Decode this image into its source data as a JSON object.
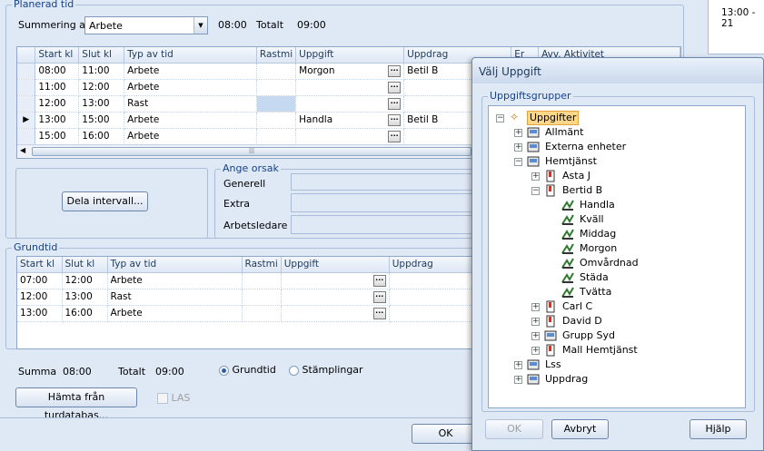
{
  "planerad": {
    "title": "Planerad tid",
    "summering_label": "Summering av",
    "summering_value": "Arbete",
    "sum_time": "08:00",
    "totalt_label": "Totalt",
    "totalt_time": "09:00",
    "columns": [
      "Start kl",
      "Slut kl",
      "Typ av tid",
      "Rastmi",
      "Uppgift",
      "Uppdrag",
      "Er",
      "Avv. Aktivitet"
    ],
    "rows": [
      {
        "start": "08:00",
        "slut": "11:00",
        "typ": "Arbete",
        "uppgift": "Morgon",
        "uppdrag": "Betil B"
      },
      {
        "start": "11:00",
        "slut": "12:00",
        "typ": "Arbete",
        "uppgift": "",
        "uppdrag": ""
      },
      {
        "start": "12:00",
        "slut": "13:00",
        "typ": "Rast",
        "uppgift": "",
        "uppdrag": ""
      },
      {
        "start": "13:00",
        "slut": "15:00",
        "typ": "Arbete",
        "uppgift": "Handla",
        "uppdrag": "Betil B"
      },
      {
        "start": "15:00",
        "slut": "16:00",
        "typ": "Arbete",
        "uppgift": "",
        "uppdrag": ""
      }
    ],
    "dela_button": "Dela intervall...",
    "orsak_title": "Ange orsak",
    "orsak_fields": [
      "Generell",
      "Extra",
      "Arbetsledare"
    ]
  },
  "grundtid": {
    "title": "Grundtid",
    "columns": [
      "Start kl",
      "Slut kl",
      "Typ av tid",
      "Rastmi",
      "Uppgift",
      "Uppdrag"
    ],
    "rows": [
      {
        "start": "07:00",
        "slut": "12:00",
        "typ": "Arbete"
      },
      {
        "start": "12:00",
        "slut": "13:00",
        "typ": "Rast"
      },
      {
        "start": "13:00",
        "slut": "16:00",
        "typ": "Arbete"
      }
    ]
  },
  "summary": {
    "summa_label": "Summa",
    "summa_time": "08:00",
    "totalt_label": "Totalt",
    "totalt_time": "09:00",
    "radio_grundtid": "Grundtid",
    "radio_stamplingar": "Stämplingar",
    "hamta_button": "Hämta från turdatabas...",
    "las_label": "LAS"
  },
  "right_panel": {
    "time_text": "13:00 - 21"
  },
  "footer": {
    "ok": "OK"
  },
  "dialog": {
    "title": "Välj Uppgift",
    "group_title": "Uppgiftsgrupper",
    "ok": "OK",
    "avbryt": "Avbryt",
    "hjalp": "Hjälp",
    "tree": {
      "root": "Uppgifter",
      "l1": [
        "Allmänt",
        "Externa enheter",
        "Hemtjänst",
        "Lss",
        "Uppdrag"
      ],
      "hemtjanst": [
        "Asta J",
        "Bertid B",
        "Carl C",
        "David D",
        "Grupp Syd",
        "Mall Hemtjänst"
      ],
      "bertid": [
        "Handla",
        "Kväll",
        "Middag",
        "Morgon",
        "Omvårdnad",
        "Städa",
        "Tvätta"
      ]
    }
  }
}
